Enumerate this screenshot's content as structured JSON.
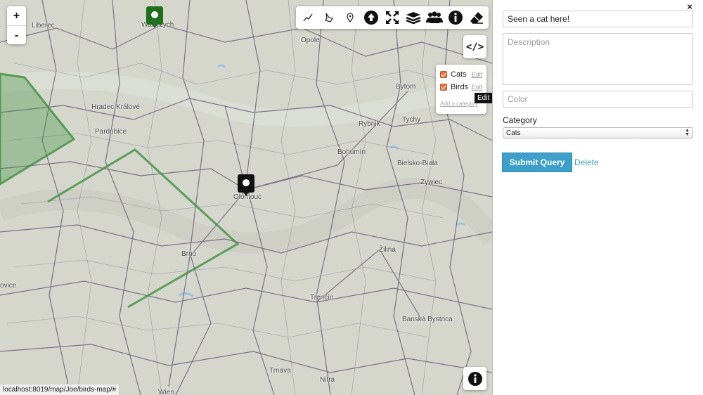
{
  "map": {
    "zoom_in": "+",
    "zoom_out": "-",
    "places": [
      {
        "name": "Liberec"
      },
      {
        "name": "Wałbrzych"
      },
      {
        "name": "Opole"
      },
      {
        "name": "Hradec Králové"
      },
      {
        "name": "Pardubice"
      },
      {
        "name": "Bytom"
      },
      {
        "name": "Rybnik"
      },
      {
        "name": "Tychy"
      },
      {
        "name": "Bohumín"
      },
      {
        "name": "Bielsko-Biała"
      },
      {
        "name": "Żywiec"
      },
      {
        "name": "Olomouc"
      },
      {
        "name": "Brno"
      },
      {
        "name": "Žilina"
      },
      {
        "name": "ovice"
      },
      {
        "name": "Trenčín"
      },
      {
        "name": "Banská Bystrica"
      },
      {
        "name": "Trnava"
      },
      {
        "name": "Nitra"
      },
      {
        "name": "Wien"
      }
    ],
    "toolbar_icons": [
      "draw-line-icon",
      "draw-polygon-icon",
      "add-marker-icon",
      "upload-icon",
      "fullscreen-icon",
      "layers-icon",
      "users-icon",
      "info-icon",
      "eraser-icon"
    ],
    "embed_label": "</>",
    "layers": [
      {
        "name": "Cats",
        "checked": true,
        "edit": "Edit"
      },
      {
        "name": "Birds",
        "checked": true,
        "edit": "Edit"
      }
    ],
    "add_category": "Add a category",
    "tooltip": "Edit",
    "colors": {
      "polygon": "#3d8f3d",
      "marker_green": "#1e6f1e",
      "marker_black": "#111111"
    },
    "status_url": "localhost:8019/map/Joe/birds-map/#"
  },
  "panel": {
    "close": "×",
    "name_value": "Seen a cat here!",
    "description_placeholder": "Description",
    "color_placeholder": "Color",
    "category_label": "Category",
    "category_value": "Cats",
    "submit_label": "Submit Query",
    "delete_label": "Delete"
  }
}
